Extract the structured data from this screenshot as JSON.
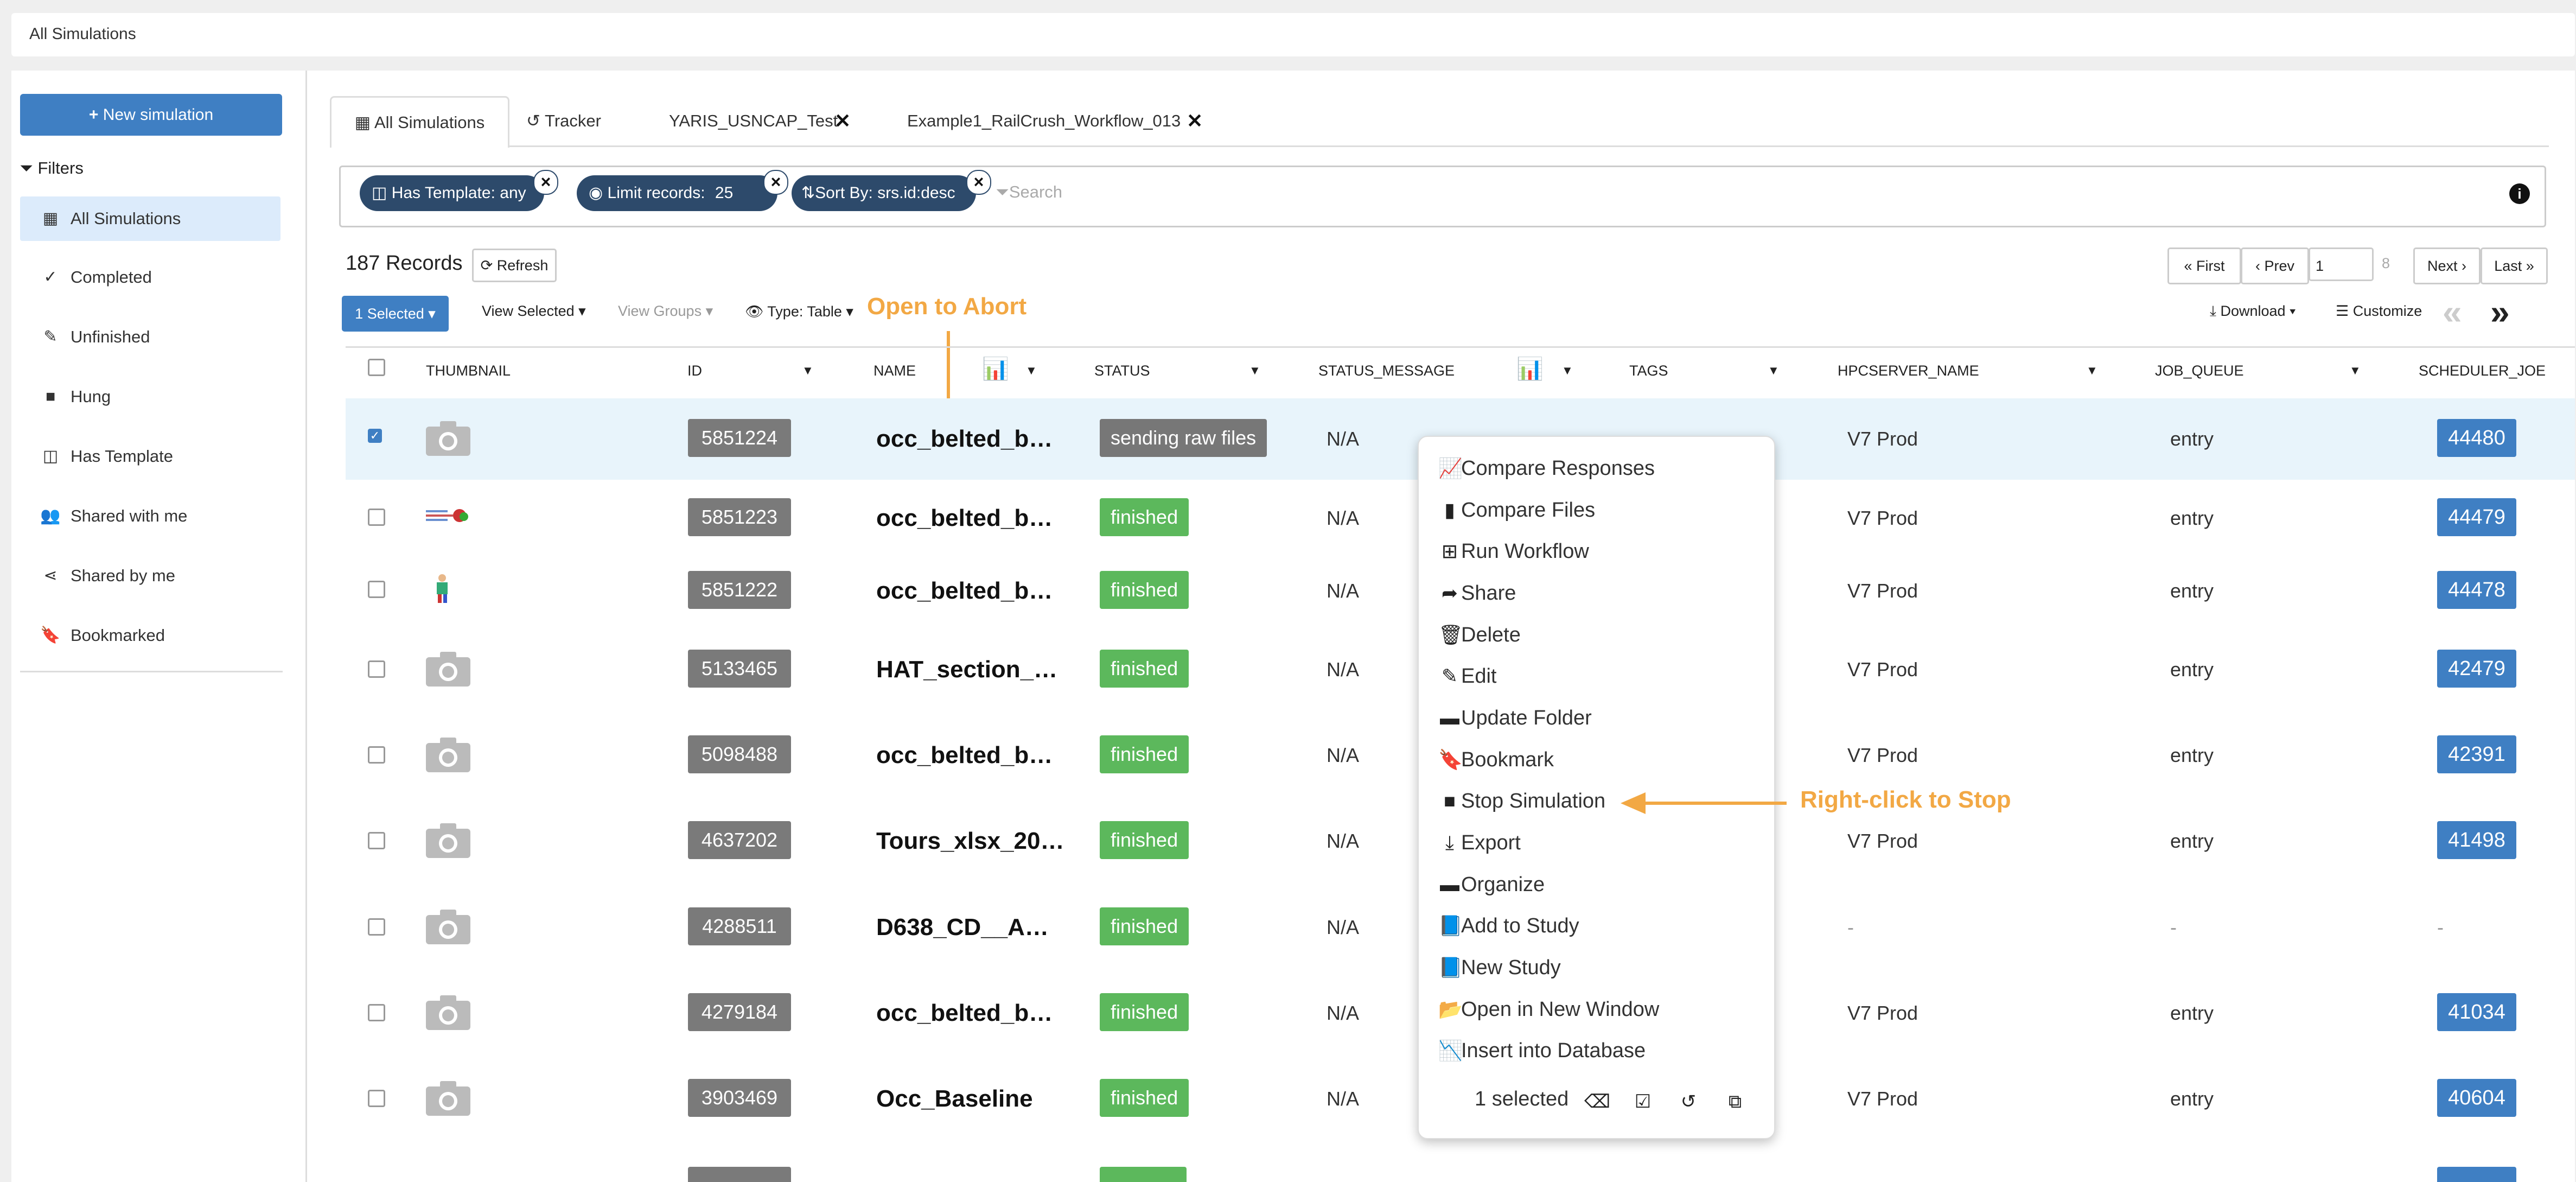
{
  "breadcrumb": "All Simulations",
  "sidebar": {
    "new_sim": "New simulation",
    "filters": "Filters",
    "items": [
      {
        "label": "All Simulations",
        "icon": "table-icon"
      },
      {
        "label": "Completed",
        "icon": "check-icon"
      },
      {
        "label": "Unfinished",
        "icon": "edit-icon"
      },
      {
        "label": "Hung",
        "icon": "stop-icon"
      },
      {
        "label": "Has Template",
        "icon": "template-icon"
      },
      {
        "label": "Shared with me",
        "icon": "users-icon"
      },
      {
        "label": "Shared by me",
        "icon": "share-alt-icon"
      },
      {
        "label": "Bookmarked",
        "icon": "bookmark-icon"
      }
    ]
  },
  "tabs": [
    {
      "label": "All Simulations"
    },
    {
      "label": "Tracker"
    },
    {
      "label": "YARIS_USNCAP_Test"
    },
    {
      "label": "Example1_RailCrush_Workflow_013"
    }
  ],
  "chips": [
    {
      "key": "Has Template:",
      "val": "any"
    },
    {
      "key": "Limit records:",
      "val": "25"
    },
    {
      "key": "Sort By:",
      "val": "srs.id:desc"
    }
  ],
  "search_placeholder": "Search",
  "records": "187 Records",
  "refresh": "Refresh",
  "pager": {
    "first": "First",
    "prev": "Prev",
    "page": "1",
    "total": "8",
    "next": "Next",
    "last": "Last"
  },
  "toolbar": {
    "selected": "1 Selected",
    "view_selected": "View Selected",
    "view_groups": "View Groups",
    "type": "Type: Table",
    "download": "Download",
    "customize": "Customize"
  },
  "annotations": {
    "abort": "Open to Abort",
    "stop": "Right-click to Stop"
  },
  "columns": [
    "THUMBNAIL",
    "ID",
    "NAME",
    "STATUS",
    "STATUS_MESSAGE",
    "TAGS",
    "HPCSERVER_NAME",
    "JOB_QUEUE",
    "SCHEDULER_JOE"
  ],
  "rows": [
    {
      "id": "5851224",
      "name": "occ_belted_b…",
      "status": "sending raw files",
      "msg": "N/A",
      "server": "V7 Prod",
      "queue": "entry",
      "job": "44480"
    },
    {
      "id": "5851223",
      "name": "occ_belted_b…",
      "status": "finished",
      "msg": "N/A",
      "server": "V7 Prod",
      "queue": "entry",
      "job": "44479"
    },
    {
      "id": "5851222",
      "name": "occ_belted_b…",
      "status": "finished",
      "msg": "N/A",
      "server": "V7 Prod",
      "queue": "entry",
      "job": "44478"
    },
    {
      "id": "5133465",
      "name": "HAT_section_…",
      "status": "finished",
      "msg": "N/A",
      "server": "V7 Prod",
      "queue": "entry",
      "job": "42479"
    },
    {
      "id": "5098488",
      "name": "occ_belted_b…",
      "status": "finished",
      "msg": "N/A",
      "server": "V7 Prod",
      "queue": "entry",
      "job": "42391"
    },
    {
      "id": "4637202",
      "name": "Tours_xlsx_20…",
      "status": "finished",
      "msg": "N/A",
      "server": "V7 Prod",
      "queue": "entry",
      "job": "41498"
    },
    {
      "id": "4288511",
      "name": "D638_CD__A…",
      "status": "finished",
      "msg": "N/A",
      "server": "-",
      "queue": "-",
      "job": "-"
    },
    {
      "id": "4279184",
      "name": "occ_belted_b…",
      "status": "finished",
      "msg": "N/A",
      "server": "V7 Prod",
      "queue": "entry",
      "job": "41034"
    },
    {
      "id": "3903469",
      "name": "Occ_Baseline",
      "status": "finished",
      "msg": "N/A",
      "server": "V7 Prod",
      "queue": "entry",
      "job": "40604"
    }
  ],
  "menu": [
    {
      "label": "Compare Responses",
      "icon": "line-chart-icon"
    },
    {
      "label": "Compare Files",
      "icon": "file-icon"
    },
    {
      "label": "Run Workflow",
      "icon": "sitemap-icon"
    },
    {
      "label": "Share",
      "icon": "share-icon"
    },
    {
      "label": "Delete",
      "icon": "trash-icon"
    },
    {
      "label": "Edit",
      "icon": "edit-icon"
    },
    {
      "label": "Update Folder",
      "icon": "folder-icon"
    },
    {
      "label": "Bookmark",
      "icon": "bookmark-icon"
    },
    {
      "label": "Stop Simulation",
      "icon": "stop-icon"
    },
    {
      "label": "Export",
      "icon": "download-icon"
    },
    {
      "label": "Organize",
      "icon": "folder-icon"
    },
    {
      "label": "Add to Study",
      "icon": "book-icon"
    },
    {
      "label": "New Study",
      "icon": "book-icon"
    },
    {
      "label": "Open in New Window",
      "icon": "folder-open-icon"
    },
    {
      "label": "Insert into Database",
      "icon": "area-chart-icon"
    }
  ],
  "menu_footer": "1 selected",
  "colors": {
    "accent": "#3f7fc3",
    "annotation": "#f2a844",
    "finished": "#5cb85c",
    "chip": "#2d4a6b"
  }
}
